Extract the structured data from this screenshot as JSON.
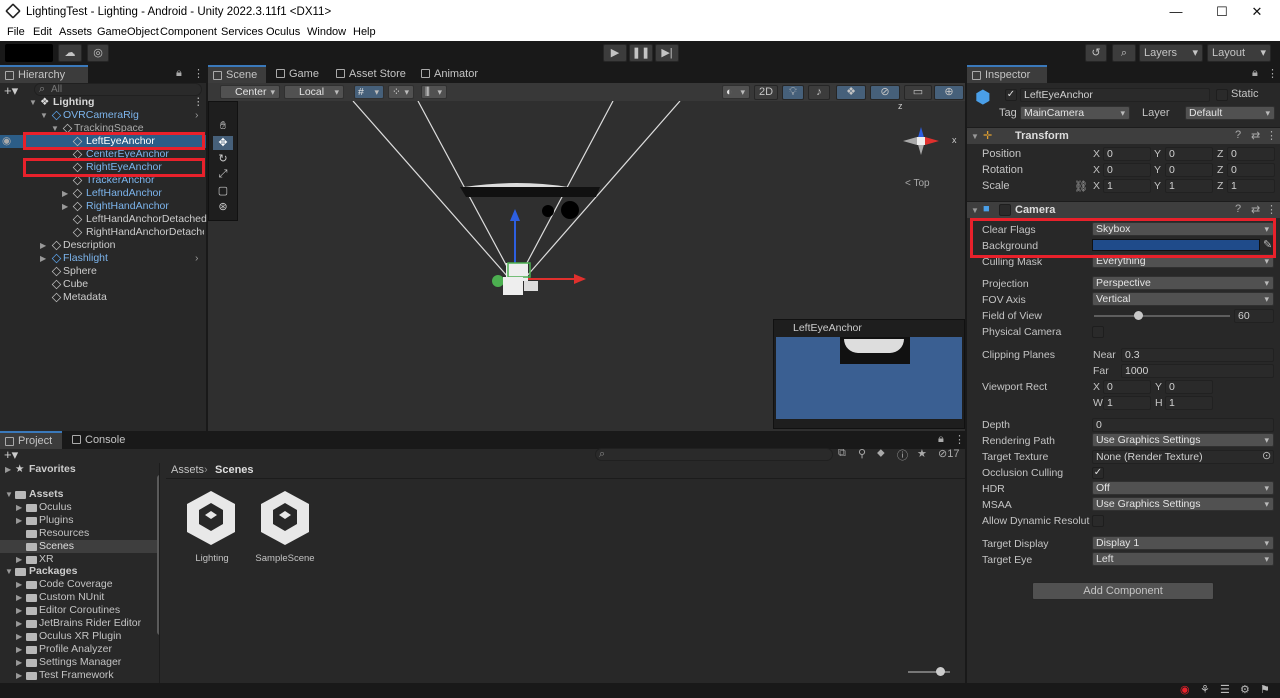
{
  "title_bar": {
    "title": "LightingTest - Lighting - Android - Unity 2022.3.11f1 <DX11>",
    "minimize": "—",
    "maximize": "☐",
    "close": "✕"
  },
  "menu": [
    "File",
    "Edit",
    "Assets",
    "GameObject",
    "Component",
    "Services",
    "Oculus",
    "Window",
    "Help"
  ],
  "toolbar": {
    "layers": "Layers",
    "layout": "Layout"
  },
  "hierarchy": {
    "tab": "Hierarchy",
    "search_placeholder": "All",
    "scene": "Lighting",
    "items": [
      "OVRCameraRig",
      "TrackingSpace",
      "LeftEyeAnchor",
      "CenterEyeAnchor",
      "RightEyeAnchor",
      "TrackerAnchor",
      "LeftHandAnchor",
      "RightHandAnchor",
      "LeftHandAnchorDetached",
      "RightHandAnchorDetached",
      "Description",
      "Flashlight",
      "Sphere",
      "Cube",
      "Metadata"
    ]
  },
  "scene_tabs": [
    "Scene",
    "Game",
    "Asset Store",
    "Animator"
  ],
  "scene_toolbar": {
    "pivot": "Center",
    "space": "Local",
    "mode2d": "2D"
  },
  "gizmo": {
    "label": "< Top",
    "x": "x",
    "y": "y",
    "z": "z"
  },
  "camera_preview": {
    "title": "LeftEyeAnchor"
  },
  "project": {
    "tabs": [
      "Project",
      "Console"
    ],
    "breadcrumb": [
      "Assets",
      "Scenes"
    ],
    "count": "17",
    "favorites": "Favorites",
    "assets": "Assets",
    "asset_folders": [
      "Oculus",
      "Plugins",
      "Resources",
      "Scenes",
      "XR"
    ],
    "packages": "Packages",
    "package_folders": [
      "Code Coverage",
      "Custom NUnit",
      "Editor Coroutines",
      "JetBrains Rider Editor",
      "Oculus XR Plugin",
      "Profile Analyzer",
      "Settings Manager",
      "Test Framework"
    ],
    "files": [
      "Lighting",
      "SampleScene"
    ]
  },
  "inspector": {
    "tab": "Inspector",
    "object_name": "LeftEyeAnchor",
    "static": "Static",
    "tag_label": "Tag",
    "tag": "MainCamera",
    "layer_label": "Layer",
    "layer": "Default",
    "transform": {
      "title": "Transform",
      "position": "Position",
      "rotation": "Rotation",
      "scale": "Scale",
      "pos": [
        "0",
        "0",
        "0"
      ],
      "rot": [
        "0",
        "0",
        "0"
      ],
      "scl": [
        "1",
        "1",
        "1"
      ],
      "axes": [
        "X",
        "Y",
        "Z"
      ]
    },
    "camera": {
      "title": "Camera",
      "clear_flags_label": "Clear Flags",
      "clear_flags": "Skybox",
      "background_label": "Background",
      "background_color": "#1f4b8a",
      "culling_mask_label": "Culling Mask",
      "culling_mask": "Everything",
      "projection_label": "Projection",
      "projection": "Perspective",
      "fov_axis_label": "FOV Axis",
      "fov_axis": "Vertical",
      "fov_label": "Field of View",
      "fov": "60",
      "physical_label": "Physical Camera",
      "clipping_label": "Clipping Planes",
      "near_label": "Near",
      "near": "0.3",
      "far_label": "Far",
      "far": "1000",
      "viewport_label": "Viewport Rect",
      "vx": "0",
      "vy": "0",
      "vw": "1",
      "vh": "1",
      "x": "X",
      "y": "Y",
      "w": "W",
      "h": "H",
      "depth_label": "Depth",
      "depth": "0",
      "rendering_path_label": "Rendering Path",
      "rendering_path": "Use Graphics Settings",
      "target_texture_label": "Target Texture",
      "target_texture": "None (Render Texture)",
      "occlusion_label": "Occlusion Culling",
      "hdr_label": "HDR",
      "hdr": "Off",
      "msaa_label": "MSAA",
      "msaa": "Use Graphics Settings",
      "dynamic_label": "Allow Dynamic Resolutio",
      "target_display_label": "Target Display",
      "target_display": "Display 1",
      "target_eye_label": "Target Eye",
      "target_eye": "Left"
    },
    "add_component": "Add Component"
  }
}
